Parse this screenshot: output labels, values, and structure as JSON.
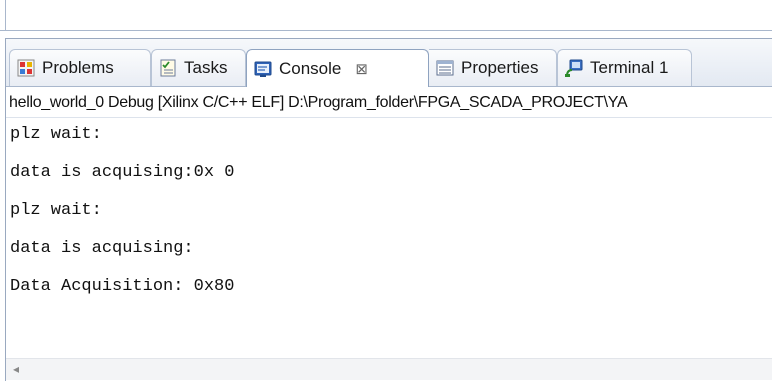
{
  "tabs": [
    {
      "label": "Problems",
      "icon": "problems-icon",
      "active": false
    },
    {
      "label": "Tasks",
      "icon": "tasks-icon",
      "active": false
    },
    {
      "label": "Console",
      "icon": "console-icon",
      "active": true,
      "close": "⊠"
    },
    {
      "label": "Properties",
      "icon": "properties-icon",
      "active": false
    },
    {
      "label": "Terminal 1",
      "icon": "terminal-icon",
      "active": false
    }
  ],
  "launch_description": "hello_world_0 Debug [Xilinx C/C++ ELF] D:\\Program_folder\\FPGA_SCADA_PROJECT\\YA",
  "console_lines": [
    "plz wait:",
    "data is acquising:0x 0",
    "plz wait:",
    "data is acquising:",
    "Data Acquisition: 0x80"
  ],
  "scroll_left_arrow": "◂",
  "colors": {
    "tab_border": "#8fa3c0",
    "frame_border": "#9aa9c0"
  }
}
